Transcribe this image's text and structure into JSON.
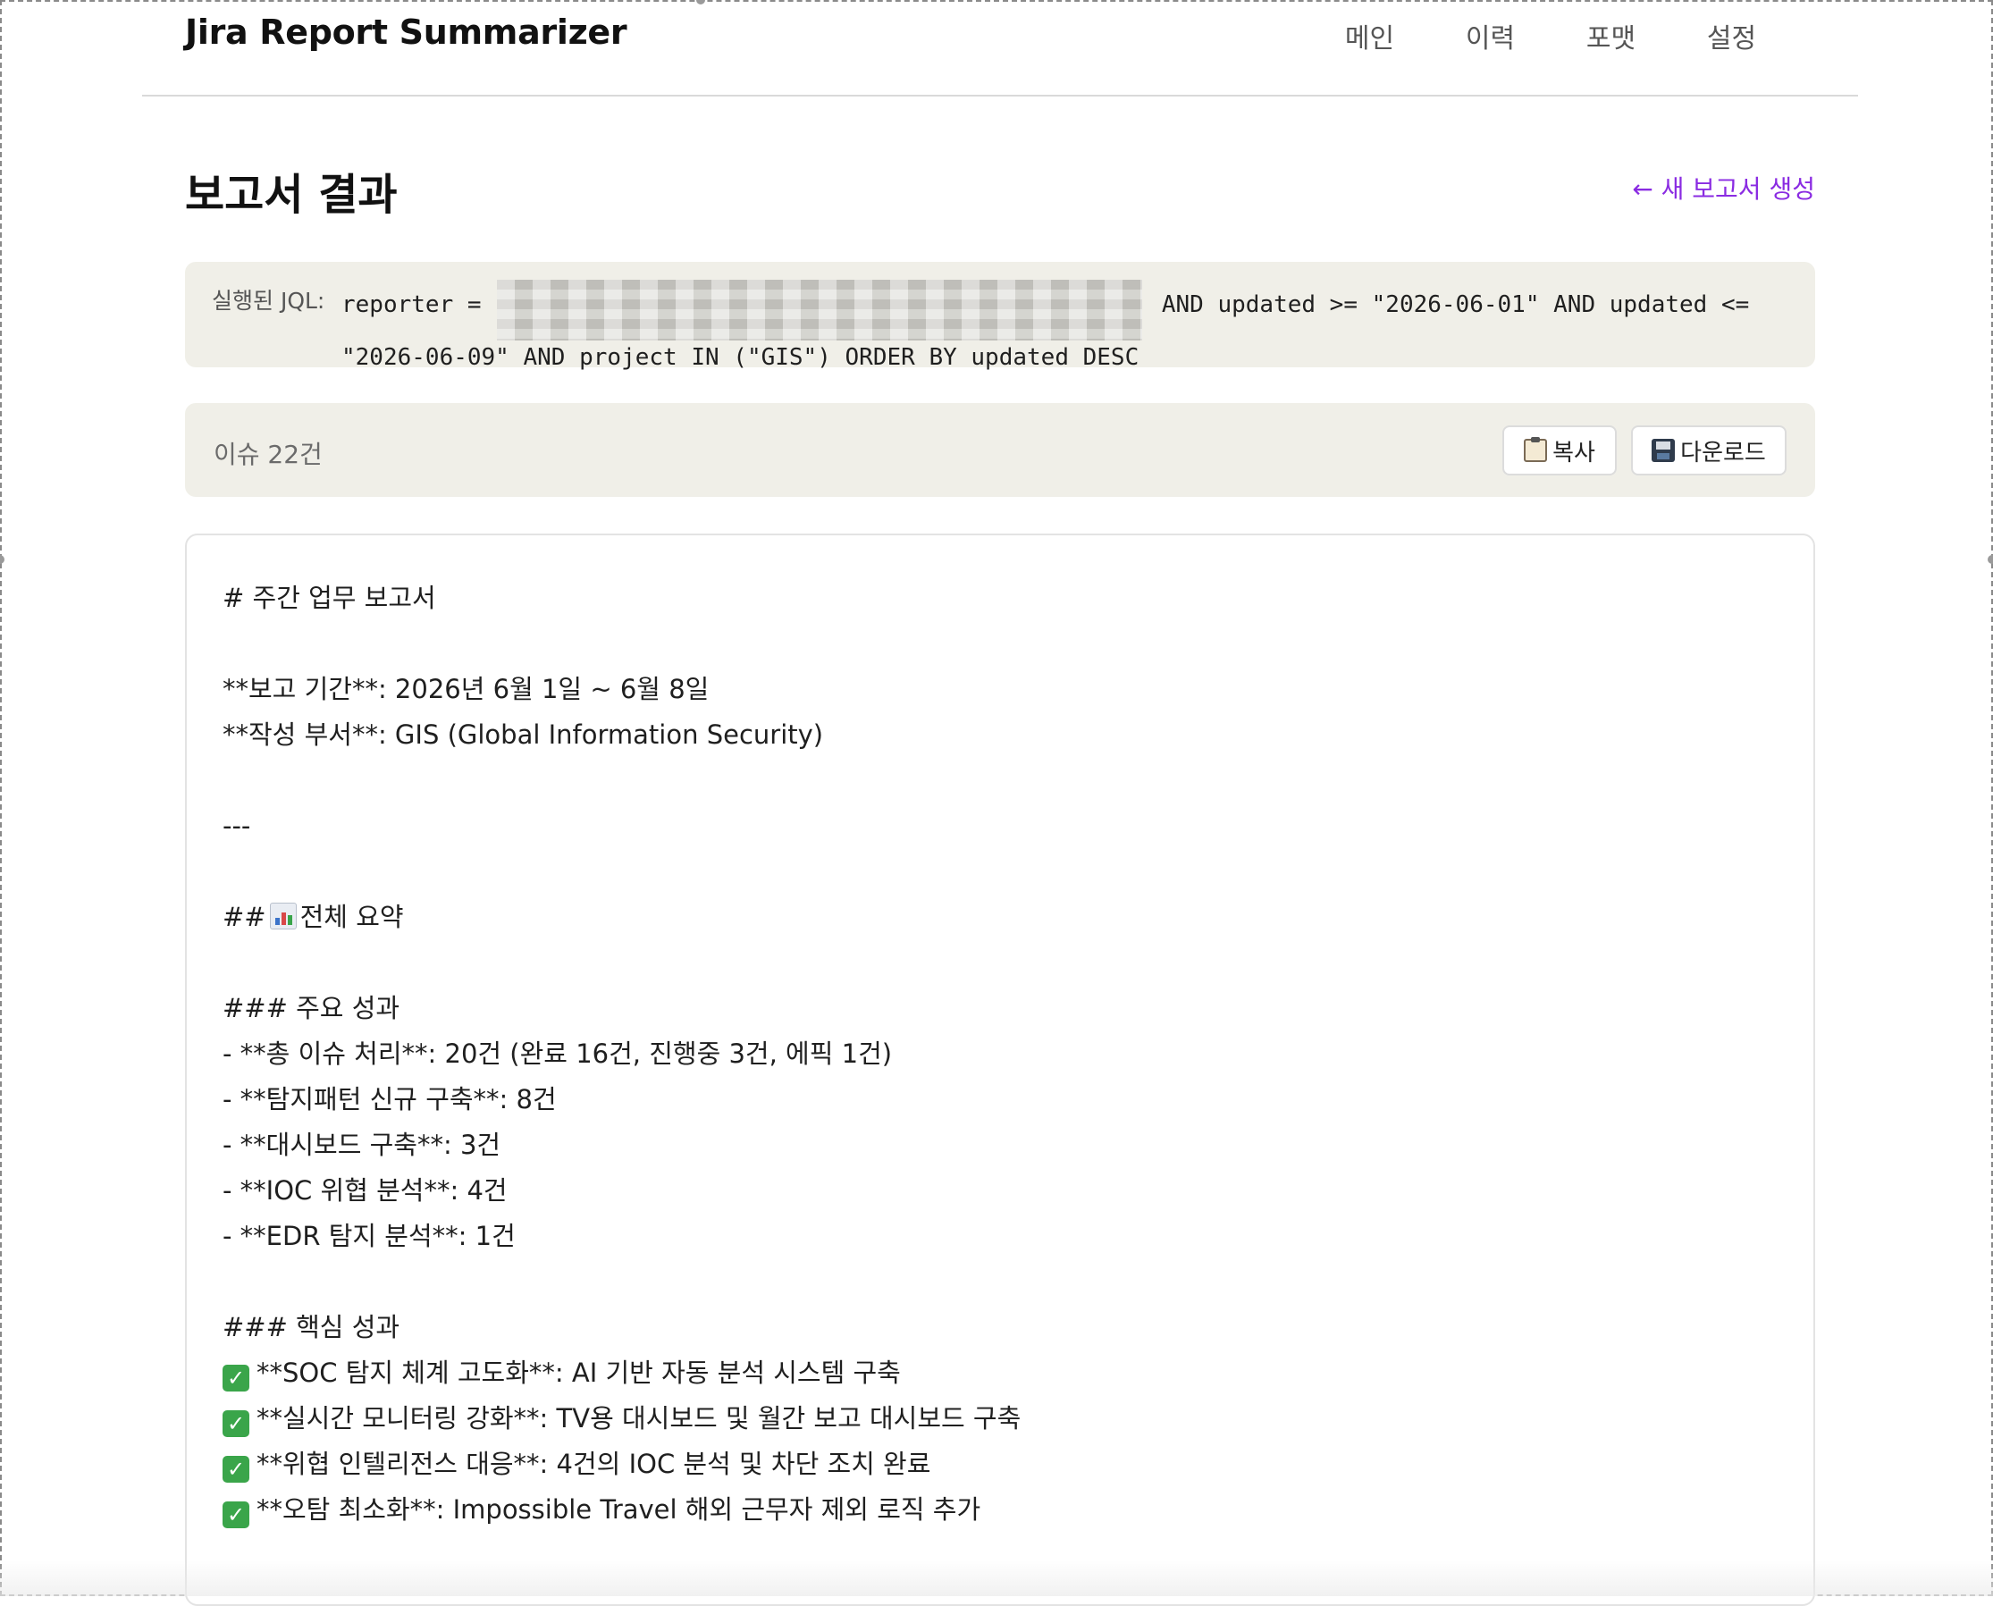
{
  "app": {
    "title": "Jira Report Summarizer"
  },
  "nav": {
    "items": [
      "메인",
      "이력",
      "포맷",
      "설정"
    ]
  },
  "page": {
    "title": "보고서 결과",
    "new_report_link": "← 새 보고서 생성"
  },
  "jql": {
    "label": "실행된 JQL:",
    "prefix": "reporter = ",
    "suffix": " AND updated >= \"2026-06-01\" AND updated <= \"2026-06-09\" AND project IN (\"GIS\") ORDER BY updated DESC"
  },
  "toolbar": {
    "issue_count": "이슈 22건",
    "copy_label": "복사",
    "download_label": "다운로드"
  },
  "report": {
    "lines": [
      {
        "type": "text",
        "text": "# 주간 업무 보고서"
      },
      {
        "type": "blank",
        "text": ""
      },
      {
        "type": "text",
        "text": "**보고 기간**: 2026년 6월 1일 ~ 6월 8일"
      },
      {
        "type": "text",
        "text": "**작성 부서**: GIS (Global Information Security)"
      },
      {
        "type": "blank",
        "text": ""
      },
      {
        "type": "text",
        "text": "---"
      },
      {
        "type": "blank",
        "text": ""
      },
      {
        "type": "chart",
        "prefix": "##",
        "text": "전체 요약"
      },
      {
        "type": "blank",
        "text": ""
      },
      {
        "type": "text",
        "text": "### 주요 성과"
      },
      {
        "type": "text",
        "text": "- **총 이슈 처리**: 20건 (완료 16건, 진행중 3건, 에픽 1건)"
      },
      {
        "type": "text",
        "text": "- **탐지패턴 신규 구축**: 8건"
      },
      {
        "type": "text",
        "text": "- **대시보드 구축**: 3건"
      },
      {
        "type": "text",
        "text": "- **IOC 위협 분석**: 4건"
      },
      {
        "type": "text",
        "text": "- **EDR 탐지 분석**: 1건"
      },
      {
        "type": "blank",
        "text": ""
      },
      {
        "type": "text",
        "text": "### 핵심 성과"
      },
      {
        "type": "check",
        "text": "**SOC 탐지 체계 고도화**: AI 기반 자동 분석 시스템 구축"
      },
      {
        "type": "check",
        "text": "**실시간 모니터링 강화**: TV용 대시보드 및 월간 보고 대시보드 구축"
      },
      {
        "type": "check",
        "text": "**위협 인텔리전스 대응**: 4건의 IOC 분석 및 차단 조치 완료"
      },
      {
        "type": "check",
        "text": "**오탐 최소화**: Impossible Travel 해외 근무자 제외 로직 추가"
      }
    ]
  },
  "colors": {
    "accent": "#8a2be2",
    "panel": "#f0efe8",
    "check": "#3aa54a"
  },
  "icons": {
    "copy": "clipboard-icon",
    "download": "floppy-disk-icon",
    "check": "check-mark-icon",
    "summary": "bar-chart-icon"
  }
}
